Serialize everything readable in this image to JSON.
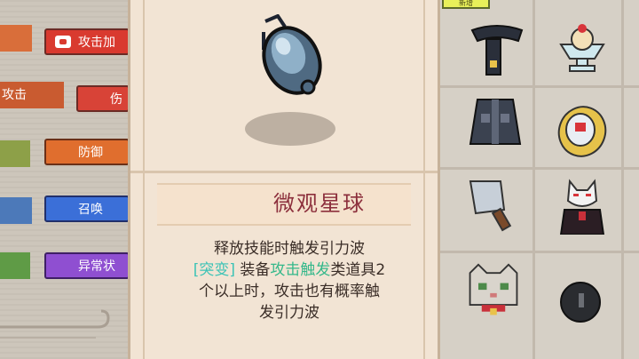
{
  "left_panel": {
    "tags": [
      {
        "label": "",
        "color": "#d96e3a"
      },
      {
        "label": "攻击",
        "color": "#c95b30"
      },
      {
        "label": "",
        "color": "#8da048"
      },
      {
        "label": "",
        "color": "#4c79b9"
      },
      {
        "label": "",
        "color": "#5f9b46"
      }
    ],
    "chips": [
      {
        "label": "攻击加",
        "color": "#d93a2f"
      },
      {
        "label": "伤",
        "color": "#d84337"
      },
      {
        "label": "防御",
        "color": "#e06e2e"
      },
      {
        "label": "召唤",
        "color": "#3b6fd8"
      },
      {
        "label": "异常状",
        "color": "#8f4fd1"
      }
    ]
  },
  "item": {
    "name": "微观星球",
    "description_line1": "释放技能时触发引力波",
    "mod_tag": "[突变]",
    "line2_a": " 装备",
    "line2_highlight": "攻击触发",
    "line2_b": "类道具2",
    "line3": "个以上时，攻击也有概率触",
    "line4": "发引力波",
    "icon": "micro-planet-orb"
  },
  "inventory": {
    "badge": "新增",
    "items": [
      "black-scarf",
      "ice-cream-sundae",
      "dark-vest",
      "egg-capsule",
      "cleaver",
      "fox-mask-figure",
      "cat-face",
      "black-bomb"
    ]
  },
  "colors": {
    "title": "#8c2f3c",
    "mutation": "#3cc3b6",
    "highlight": "#34b88a"
  }
}
